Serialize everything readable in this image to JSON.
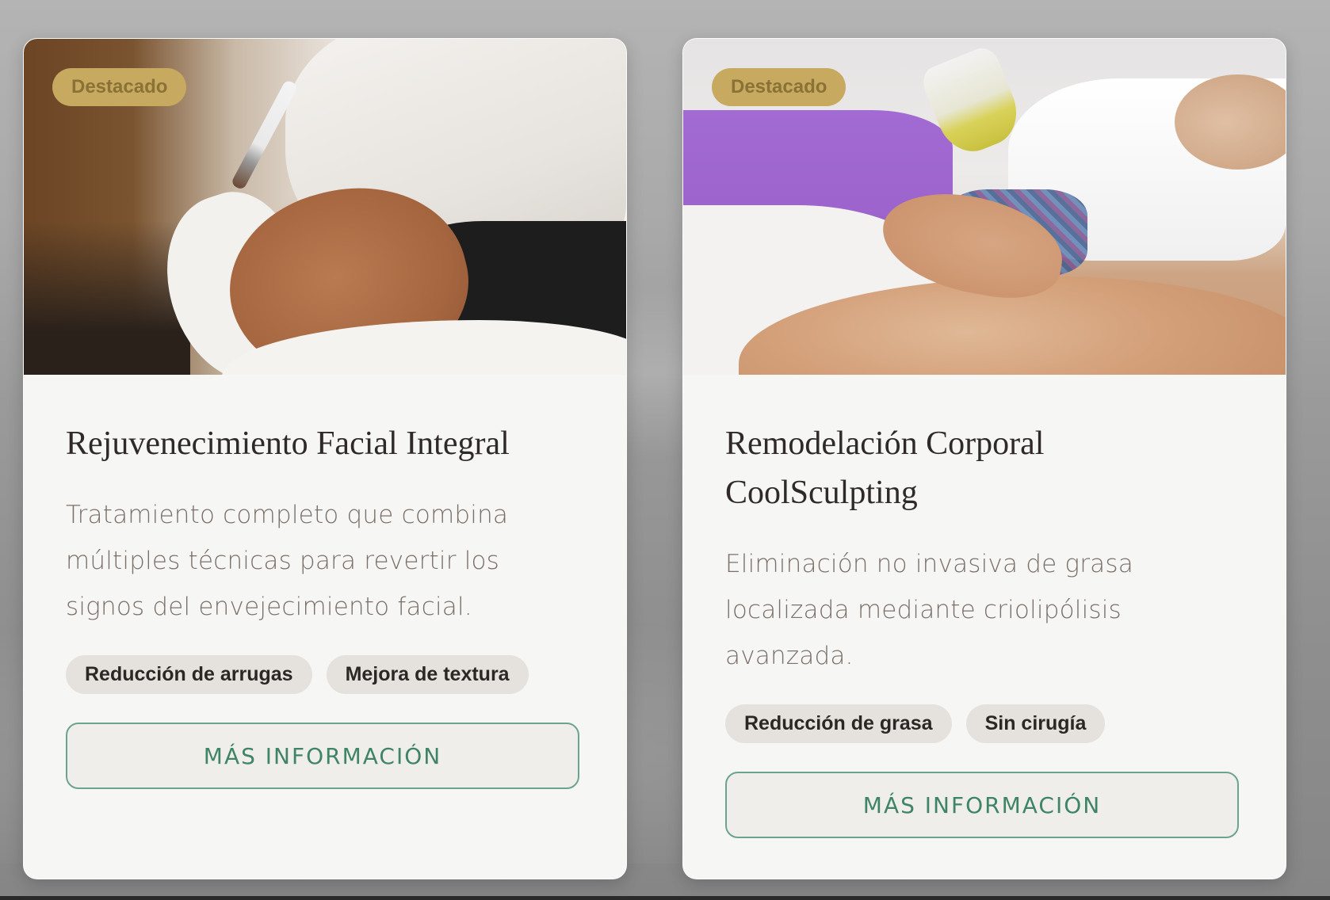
{
  "cards": [
    {
      "badge": "Destacado",
      "title": "Rejuvenecimiento Facial Integral",
      "description": "Tratamiento completo que combina múltiples técnicas para revertir los signos del envejecimiento facial.",
      "tags": [
        "Reducción de arrugas",
        "Mejora de textura"
      ],
      "button_label": "MÁS INFORMACIÓN",
      "image": "facial-treatment-photo"
    },
    {
      "badge": "Destacado",
      "title": "Remodelación Corporal CoolSculpting",
      "description": "Eliminación no invasiva de grasa localizada mediante criolipólisis avanzada.",
      "tags": [
        "Reducción de grasa",
        "Sin cirugía"
      ],
      "button_label": "MÁS INFORMACIÓN",
      "image": "body-massage-photo"
    }
  ],
  "colors": {
    "badge": "#c7aa5f",
    "accent_green": "#3e8465",
    "chip_bg": "#e5e2de"
  }
}
